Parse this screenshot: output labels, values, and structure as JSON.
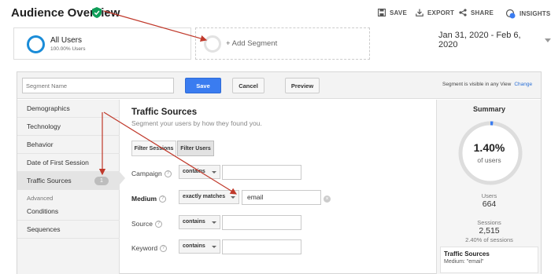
{
  "header": {
    "title": "Audience Overview",
    "actions": [
      {
        "icon": "save-icon",
        "label": "SAVE"
      },
      {
        "icon": "export-icon",
        "label": "EXPORT"
      },
      {
        "icon": "share-icon",
        "label": "SHARE"
      },
      {
        "icon": "insights-icon",
        "label": "INSIGHTS",
        "badge": "7"
      }
    ]
  },
  "segments": {
    "current_name": "All Users",
    "current_sub": "100.00% Users",
    "add_label": "+ Add Segment"
  },
  "date_range": "Jan 31, 2020 - Feb 6, 2020",
  "editor": {
    "name_placeholder": "Segment Name",
    "save_label": "Save",
    "cancel_label": "Cancel",
    "preview_label": "Preview",
    "visibility_note": "Segment is visible in any View",
    "change_label": "Change",
    "menu": [
      {
        "label": "Demographics"
      },
      {
        "label": "Technology"
      },
      {
        "label": "Behavior"
      },
      {
        "label": "Date of First Session"
      },
      {
        "label": "Traffic Sources",
        "badge": "1",
        "active": true
      }
    ],
    "advanced_header": "Advanced",
    "advanced_items": [
      {
        "label": "Conditions"
      },
      {
        "label": "Sequences"
      }
    ],
    "content_title": "Traffic Sources",
    "content_subtitle": "Segment your users by how they found you.",
    "toggle_sessions": "Filter Sessions",
    "toggle_users": "Filter Users",
    "filters": [
      {
        "label": "Campaign",
        "operator": "contains",
        "value": ""
      },
      {
        "label": "Medium",
        "operator": "exactly matches",
        "value": "email"
      },
      {
        "label": "Source",
        "operator": "contains",
        "value": ""
      },
      {
        "label": "Keyword",
        "operator": "contains",
        "value": ""
      }
    ]
  },
  "summary": {
    "title": "Summary",
    "percent": "1.40%",
    "percent_fraction": 0.014,
    "percent_label": "of users",
    "users_label": "Users",
    "users_value": "664",
    "sessions_label": "Sessions",
    "sessions_value": "2,515",
    "sessions_pct": "2.40% of sessions",
    "box_title": "Traffic Sources",
    "box_desc": "Medium: \"email\""
  },
  "colors": {
    "accent_blue": "#3a7cf0",
    "segment_ring": "#1a8cd8",
    "verified_green": "#0f9d58",
    "annotation_red": "#c0392b"
  }
}
